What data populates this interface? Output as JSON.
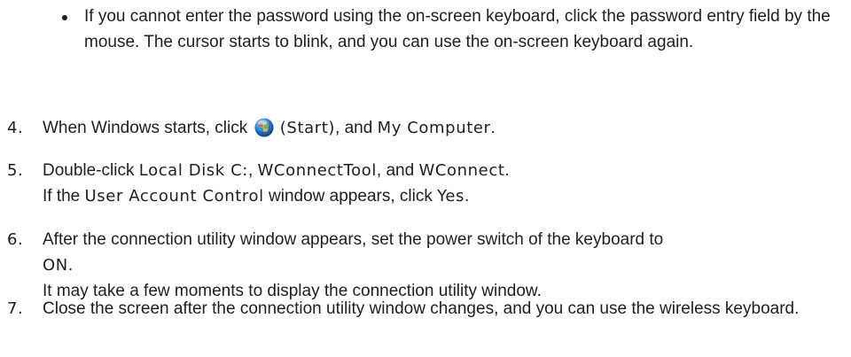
{
  "bullet": {
    "text": "If you cannot enter the password using the on-screen keyboard, click the password entry field by the mouse. The cursor starts to blink, and you can use the on-screen keyboard again."
  },
  "steps": [
    {
      "number": "4.",
      "part1": "When Windows starts, click",
      "icon": "windows-start-orb-icon",
      "term1": "(Start)",
      "part2": ", and",
      "term2": "My Computer",
      "part3": "."
    },
    {
      "number": "5.",
      "part1": "Double-click",
      "term1": "Local Disk C:",
      "sep1": ",",
      "term2": "WConnectTool",
      "sep2": ", and",
      "term3": "WConnect",
      "end": ".",
      "line2_part1": "If the",
      "line2_term1": "User Account Control",
      "line2_part2": "window appears, click",
      "line2_term2": "Yes",
      "line2_end": "."
    },
    {
      "number": "6.",
      "part1": "After the connection utility window appears, set the power switch of the keyboard to",
      "term1": "ON",
      "end": ".",
      "line2": "It may take a few moments to display the connection utility window."
    },
    {
      "number": "7.",
      "text": "Close the screen after the connection utility window changes, and you can use the wireless keyboard."
    }
  ],
  "colors": {
    "text": "#1f1f1f",
    "orb_blue": "#2b7bd8"
  }
}
